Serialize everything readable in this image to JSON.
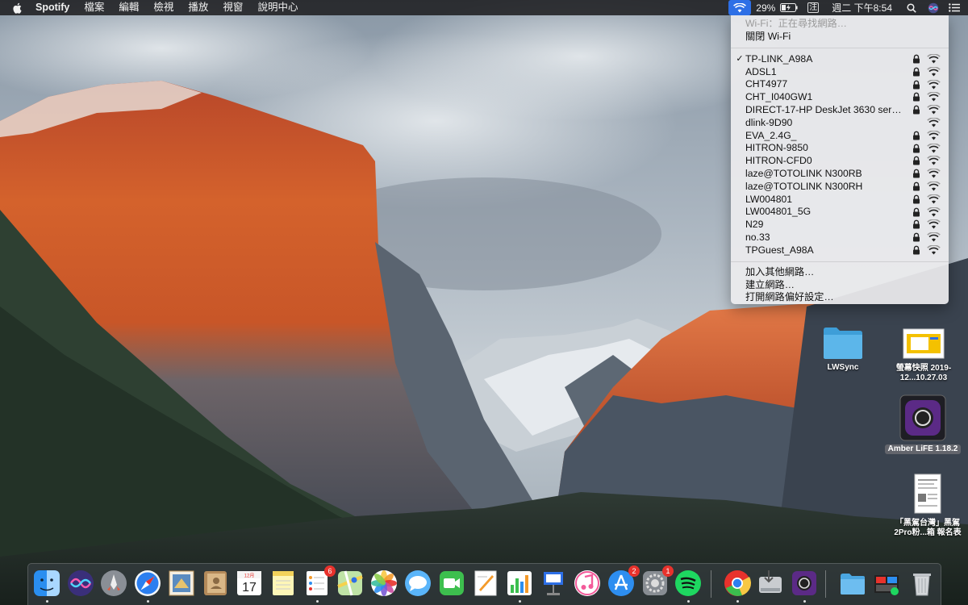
{
  "menubar": {
    "apple_icon": "apple-icon",
    "app_name": "Spotify",
    "menus": [
      "檔案",
      "編輯",
      "檢視",
      "播放",
      "視窗",
      "說明中心"
    ],
    "battery_percent": "29%",
    "input_method": "注",
    "clock": "週二 下午8:54"
  },
  "wifi_menu": {
    "status": "Wi-Fi：正在尋找網路…",
    "toggle": "關閉 Wi-Fi",
    "networks": [
      {
        "ssid": "TP-LINK_A98A",
        "connected": true,
        "locked": true
      },
      {
        "ssid": "ADSL1",
        "connected": false,
        "locked": true
      },
      {
        "ssid": "CHT4977",
        "connected": false,
        "locked": true
      },
      {
        "ssid": "CHT_I040GW1",
        "connected": false,
        "locked": true
      },
      {
        "ssid": "DIRECT-17-HP DeskJet 3630 series",
        "connected": false,
        "locked": true
      },
      {
        "ssid": "dlink-9D90",
        "connected": false,
        "locked": false
      },
      {
        "ssid": "EVA_2.4G_",
        "connected": false,
        "locked": true
      },
      {
        "ssid": "HITRON-9850",
        "connected": false,
        "locked": true
      },
      {
        "ssid": "HITRON-CFD0",
        "connected": false,
        "locked": true
      },
      {
        "ssid": "laze@TOTOLINK N300RB",
        "connected": false,
        "locked": true
      },
      {
        "ssid": "laze@TOTOLINK N300RH",
        "connected": false,
        "locked": true
      },
      {
        "ssid": "LW004801",
        "connected": false,
        "locked": true
      },
      {
        "ssid": "LW004801_5G",
        "connected": false,
        "locked": true
      },
      {
        "ssid": "N29",
        "connected": false,
        "locked": true
      },
      {
        "ssid": "no.33",
        "connected": false,
        "locked": true
      },
      {
        "ssid": "TPGuest_A98A",
        "connected": false,
        "locked": true
      }
    ],
    "actions": [
      "加入其他網路…",
      "建立網路…",
      "打開網路偏好設定…"
    ]
  },
  "desktop": {
    "icons": [
      {
        "label": "LWSync",
        "kind": "folder"
      },
      {
        "label": "螢幕快照 2019-12...10.27.03",
        "kind": "screenshot"
      },
      {
        "label": "Amber LiFE 1.18.2",
        "kind": "app"
      },
      {
        "label": "「黑駕台灣」黑駕 2Pro粉...箱 報名表",
        "kind": "document"
      }
    ]
  },
  "dock": {
    "apps": [
      {
        "name": "Finder",
        "icon": "finder-icon",
        "running": true
      },
      {
        "name": "Siri",
        "icon": "siri-icon",
        "running": false
      },
      {
        "name": "Launchpad",
        "icon": "launchpad-icon",
        "running": false
      },
      {
        "name": "Safari",
        "icon": "safari-icon",
        "running": true
      },
      {
        "name": "Mail",
        "icon": "mail-icon",
        "running": false
      },
      {
        "name": "Contacts",
        "icon": "contacts-icon",
        "running": false
      },
      {
        "name": "Calendar",
        "icon": "calendar-icon",
        "running": false,
        "month": "12月",
        "day": "17"
      },
      {
        "name": "Notes",
        "icon": "notes-icon",
        "running": false
      },
      {
        "name": "Reminders",
        "icon": "reminders-icon",
        "running": true,
        "badge": "6"
      },
      {
        "name": "Maps",
        "icon": "maps-icon",
        "running": false
      },
      {
        "name": "Photos",
        "icon": "photos-icon",
        "running": false
      },
      {
        "name": "Messages",
        "icon": "messages-icon",
        "running": false
      },
      {
        "name": "FaceTime",
        "icon": "facetime-icon",
        "running": false
      },
      {
        "name": "Pages",
        "icon": "pages-icon",
        "running": false
      },
      {
        "name": "Numbers",
        "icon": "numbers-icon",
        "running": true
      },
      {
        "name": "Keynote",
        "icon": "keynote-icon",
        "running": false
      },
      {
        "name": "iTunes",
        "icon": "itunes-icon",
        "running": false
      },
      {
        "name": "App Store",
        "icon": "app-store-icon",
        "running": false,
        "badge": "2"
      },
      {
        "name": "System Preferences",
        "icon": "system-preferences-icon",
        "running": false,
        "badge": "1"
      },
      {
        "name": "Spotify",
        "icon": "spotify-icon",
        "running": true
      },
      {
        "name": "Chrome",
        "icon": "chrome-icon",
        "running": true
      },
      {
        "name": "Disk Utility",
        "icon": "disk-utility-icon",
        "running": false
      },
      {
        "name": "Amber LiFE",
        "icon": "amber-life-icon",
        "running": true
      },
      {
        "name": "Downloads",
        "icon": "downloads-folder-icon",
        "running": false
      },
      {
        "name": "Recent",
        "icon": "recent-stack-icon",
        "running": false
      },
      {
        "name": "Trash",
        "icon": "trash-icon",
        "running": false
      }
    ]
  },
  "colors": {
    "menubar_bg": "#1c1c1e",
    "wifi_highlight": "#2d6fe6",
    "badge_red": "#e8322c",
    "cliff_orange": "#d2552a"
  }
}
